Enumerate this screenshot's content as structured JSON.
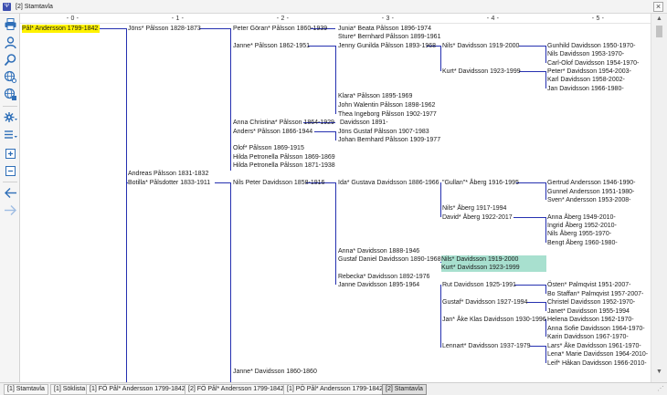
{
  "window": {
    "title": "[2] Stamtavla",
    "close_glyph": "×",
    "app_icon_glyph": "Ψ",
    "app_icon": "family-tree-app-icon"
  },
  "toolbar": {
    "icons": [
      "printer-icon",
      "person-icon",
      "search-icon",
      "globe-search-icon",
      "globe-grid-icon",
      "settings-dropdown-icon",
      "list-dropdown-icon",
      "expand-icon",
      "collapse-icon",
      "back-arrow-icon",
      "forward-arrow-icon"
    ]
  },
  "generations": [
    "- 0 -",
    "- 1 -",
    "- 2 -",
    "- 3 -",
    "- 4 -",
    "- 5 -"
  ],
  "people": {
    "g0": [
      "Pål* Andersson 1799-1842"
    ],
    "g1": [
      "Jöns* Pålsson 1828-1873",
      "Andreas Pålsson 1831-1832",
      "Botilla* Pålsdotter 1833-1911"
    ],
    "g2": [
      "Peter Göran* Pålsson 1860-1939",
      "Janne* Pålsson 1862-1951",
      "Anna Christina* Pålsson 1864-1929",
      "Anders* Pålsson 1866-1944",
      "Olof* Pålsson 1869-1915",
      "Hilda Petronella Pålsson 1869-1869",
      "Hilda Petronella Pålsson 1871-1938",
      "Nils Peter Davidsson 1858-1916",
      "Janne* Davidsson 1860-1860"
    ],
    "g3": [
      "Junia* Beata Pålsson 1896-1974",
      "Sture* Bernhard Pålsson 1899-1961",
      "Jenny Gunilda Pålsson 1893-1968",
      "Klara* Pålsson 1895-1969",
      "John Walentin Pålsson 1898-1962",
      "Thea Ingeborg Pålsson 1902-1977",
      "Davidsson 1891-",
      "Jöns Gustaf Pålsson 1907-1983",
      "Johan Bernhard Pålsson 1909-1977",
      "Ida* Gustava Davidsson 1886-1966",
      "Anna* Davidsson 1888-1946",
      "Gustaf Daniel Davidsson 1890-1968",
      "Rebecka* Davidsson 1892-1976",
      "Janne Davidsson 1895-1964"
    ],
    "g4": [
      "Nils* Davidsson 1919-2000",
      "Kurt* Davidsson 1923-1999",
      "\"Gullan\"* Åberg 1916-1995",
      "Nils* Åberg 1917-1994",
      "David* Åberg 1922-2017",
      "Nils* Davidsson 1919-2000",
      "Kurt* Davidsson 1923-1999",
      "Rut Davidsson 1925-1991",
      "Gustaf* Davidsson 1927-1994",
      "Jan* Åke Klas Davidsson 1930-1996",
      "Lennart* Davidsson 1937-1979"
    ],
    "g5": [
      "Gunhild Davidsson 1950-1970-",
      "Nils Davidsson 1953-1970-",
      "Carl-Olof Davidsson 1954-1970-",
      "Peter* Davidsson 1954-2003-",
      "Karl Davidsson 1958-2002-",
      "Jan Davidsson 1966-1980-",
      "Gertrud Andersson 1946-1990-",
      "Gunnel Andersson 1951-1980-",
      "Sven* Andersson 1953-2008-",
      "Anna Åberg 1949-2010-",
      "Ingrid Åberg 1952-2010-",
      "Nils Åberg 1955-1970-",
      "Bengt Åberg 1960-1980-",
      "Östen* Palmqvist 1951-2007-",
      "Bo Staffan* Palmqvist 1957-2007-",
      "Christel Davidsson 1952-1970-",
      "Janet* Davidsson 1955-1994",
      "Helena Davidsson 1962-1970-",
      "Anna Sofie Davidsson 1964-1970-",
      "Karin Davidsson 1967-1970-",
      "Lars* Åke Davidsson 1961-1970-",
      "Lena* Marie Davidsson 1964-2010-",
      "Leif* Håkan Davidsson 1966-2010-"
    ]
  },
  "selected_person": "Pål* Andersson 1799-1842",
  "highlighted_people": [
    "Nils* Davidsson 1919-2000",
    "Kurt* Davidsson 1923-1999"
  ],
  "scrollbar": {
    "up": "▲",
    "down": "▼"
  },
  "tabs": [
    "[1] Stamtavla",
    "[1] Söklista",
    "[1] FÖ Pål* Andersson 1799-1842",
    "[2] FÖ Pål* Andersson 1799-1842",
    "[1] PÖ Pål* Andersson 1799-1842",
    "[2] Stamtavla"
  ],
  "active_tab": "[2] Stamtavla",
  "resize_glyph": "⋰",
  "colors": {
    "selection": "#fff200",
    "highlight": "#a8e0cf",
    "connector": "#2530b0",
    "app_accent": "#3c4fb0"
  }
}
